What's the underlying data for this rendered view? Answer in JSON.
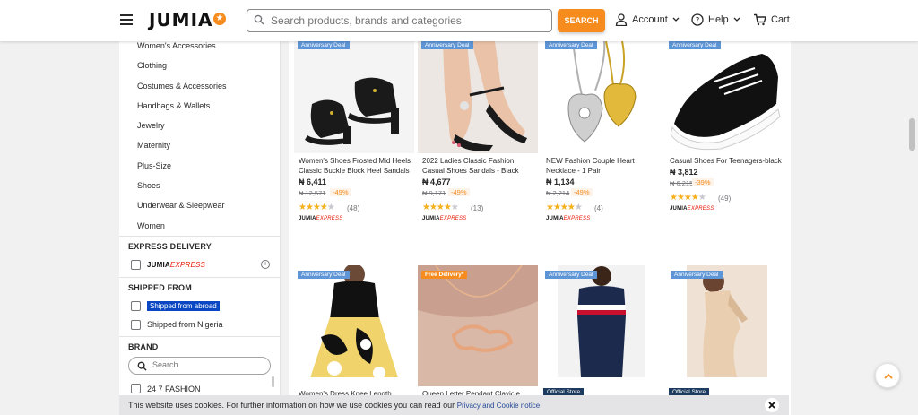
{
  "header": {
    "logo_text": "JUMIA",
    "search_placeholder": "Search products, brands and categories",
    "search_button": "SEARCH",
    "account_label": "Account",
    "help_label": "Help",
    "cart_label": "Cart"
  },
  "sidebar": {
    "categories": [
      "Women's Accessories",
      "Clothing",
      "Costumes & Accessories",
      "Handbags & Wallets",
      "Jewelry",
      "Maternity",
      "Plus-Size",
      "Shoes",
      "Underwear & Sleepwear",
      "Women"
    ],
    "express_title": "EXPRESS DELIVERY",
    "express_logo_jumia": "JUMIA",
    "express_logo_express": "EXPRESS",
    "shipped_title": "SHIPPED FROM",
    "shipped_options": [
      "Shipped from abroad",
      "Shipped from Nigeria"
    ],
    "brand_title": "BRAND",
    "brand_search_placeholder": "Search",
    "brands": [
      "24 7 FASHION"
    ]
  },
  "products": [
    {
      "badge": "Anniversary Deal",
      "name": "Women's Shoes Frosted Mid Heels Classic Buckle Block Heel Sandals",
      "price": "₦ 6,411",
      "old_price": "₦ 12,571",
      "discount": "-49%",
      "rating": 4,
      "reviews": "(48)",
      "express": true
    },
    {
      "badge": "Anniversary Deal",
      "name": "2022 Ladies Classic Fashion Casual Shoes Sandals - Black",
      "price": "₦ 4,677",
      "old_price": "₦ 9,171",
      "discount": "-49%",
      "rating": 4,
      "reviews": "(13)",
      "express": true
    },
    {
      "badge": "Anniversary Deal",
      "name": "NEW Fashion Couple Heart Necklace - 1 Pair",
      "price": "₦ 1,134",
      "old_price": "₦ 2,214",
      "discount": "-49%",
      "rating": 4,
      "reviews": "(4)",
      "express": true
    },
    {
      "badge": "Anniversary Deal",
      "name": "Casual Shoes For Teenagers-black",
      "price": "₦ 3,812",
      "old_price": "₦ 6,215",
      "discount": "-39%",
      "rating": 4,
      "reviews": "(49)",
      "express": true
    },
    {
      "badge": "Anniversary Deal",
      "name": "Women's Dress Knee Length",
      "official": ""
    },
    {
      "badge": "Free Delivery*",
      "name": "Queen Letter Pendant Clavicle",
      "official": ""
    },
    {
      "badge": "Anniversary Deal",
      "name": "",
      "official": "Official Store"
    },
    {
      "badge": "Anniversary Deal",
      "name": "",
      "official": "Official Store"
    }
  ],
  "cookie": {
    "text": "This website uses cookies. For further information on how we use cookies you can read our",
    "link": "Privacy and Cookie notice"
  },
  "icons": {
    "menu": "hamburger-icon",
    "account": "user-icon",
    "help": "help-circle-icon",
    "cart": "cart-icon",
    "close": "close-icon",
    "to_top": "chevron-up-icon"
  },
  "colors": {
    "brand_orange": "#f68b1e",
    "badge_blue": "#5e95d6",
    "express_red": "#e61601",
    "highlight_blue": "#0b47c2"
  }
}
